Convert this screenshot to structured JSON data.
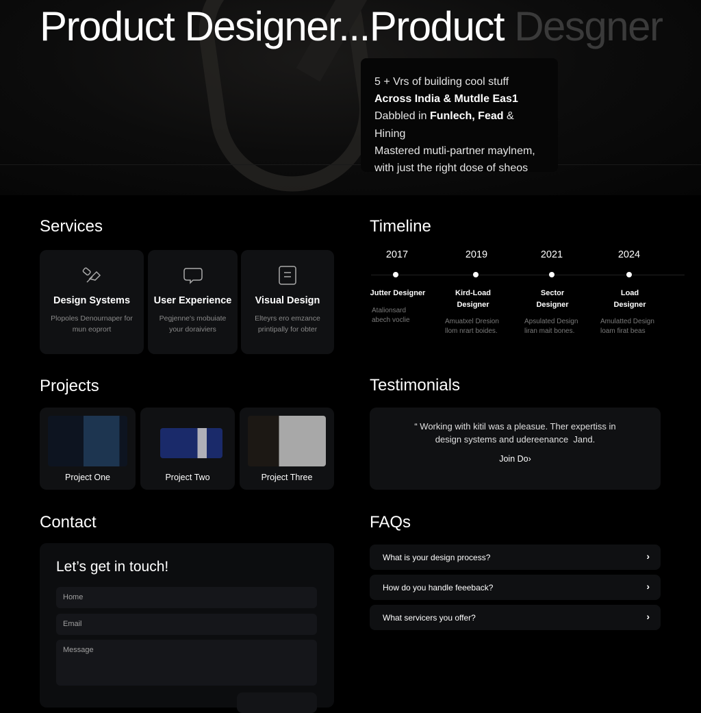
{
  "hero": {
    "title_main": "Product Designer...Product ",
    "title_faded": "Desgner",
    "info_lines": [
      {
        "normal_before": "5 + Vrs of building cool stuff",
        "bold": "",
        "normal_after": ""
      },
      {
        "normal_before": "",
        "bold": "Across India & Mutdle Eas1",
        "normal_after": ""
      },
      {
        "normal_before": "Dabbled in ",
        "bold": "Funlech, Fead",
        "normal_after": " & Hining"
      },
      {
        "normal_before": "Mastered mutli-partner maylnem,",
        "bold": "",
        "normal_after": ""
      },
      {
        "normal_before": "with just the right dose of sheos",
        "bold": "",
        "normal_after": ""
      }
    ]
  },
  "services": {
    "heading": "Services",
    "items": [
      {
        "icon": "pen-ruler-icon",
        "title": "Design Systems",
        "desc": "Plopoles Denournaper for mun eoprort"
      },
      {
        "icon": "speech-bubble-icon",
        "title": "User Experience",
        "desc": "Pegjenne's mobuiate your doraiviers"
      },
      {
        "icon": "document-icon",
        "title": "Visual Design",
        "desc": "Elteyrs ero emzance printipally for obter"
      }
    ]
  },
  "timeline": {
    "heading": "Timeline",
    "items": [
      {
        "year": "2017",
        "title": "Jutter Designer",
        "desc": "Atalionsard abech voclie"
      },
      {
        "year": "2019",
        "title": "Kird-Load Designer",
        "desc": "Amuatxel Dresion llom nrart boides."
      },
      {
        "year": "2021",
        "title": "Sector Designer",
        "desc": "Apsulated Design liran mait bones."
      },
      {
        "year": "2024",
        "title": "Load Designer",
        "desc": "Amulatted Design loam firat beas"
      }
    ]
  },
  "projects": {
    "heading": "Projects",
    "items": [
      {
        "label": "Project One"
      },
      {
        "label": "Project Two"
      },
      {
        "label": "Project Three"
      }
    ]
  },
  "testimonials": {
    "heading": "Testimonials",
    "quote": "“ Working with kitil was a pleasue. Ther expertiss in design systems and udere​enance ​ Jand.",
    "author": "Join Do›"
  },
  "contact": {
    "heading": "Contact",
    "card_title": "Let’s get in touch!",
    "name_placeholder": "Home",
    "email_placeholder": "Email",
    "message_placeholder": "Message"
  },
  "faqs": {
    "heading": "FAQs",
    "items": [
      {
        "question": "What is your design process?"
      },
      {
        "question": "How do you handle feeeback?"
      },
      {
        "question": "What servicers you offer?"
      }
    ]
  }
}
